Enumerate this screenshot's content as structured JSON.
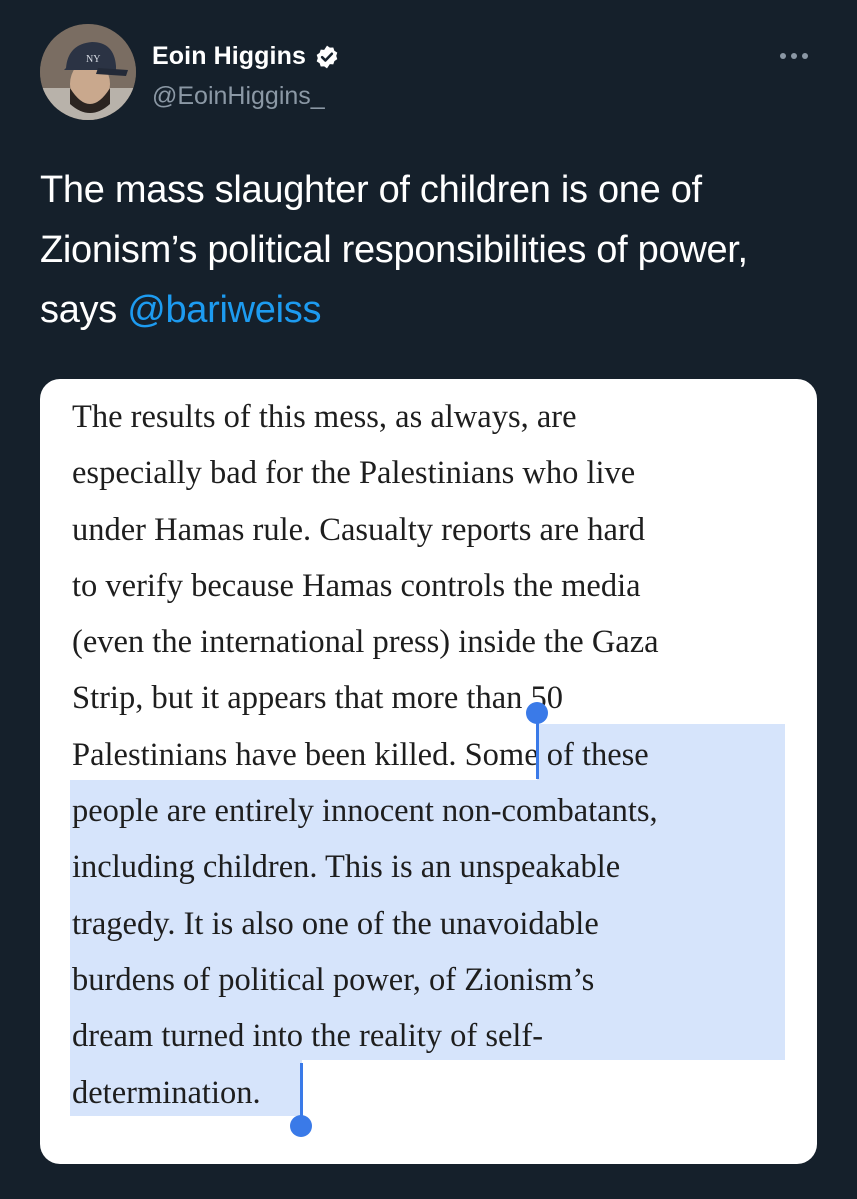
{
  "tweet": {
    "author_name": "Eoin Higgins",
    "author_handle": "@EoinHiggins_",
    "text_before_mention": "The mass slaughter of children is one of Zionism’s political responsibilities of power, says ",
    "mention": "@bariweiss"
  },
  "article": {
    "lines": [
      "The results of this mess, as always, are",
      "especially bad for the Palestinians who live",
      "under Hamas rule. Casualty reports are hard",
      "to verify because Hamas controls the media",
      "(even the international press) inside the Gaza",
      "Strip, but it appears that more than 50",
      "Palestinians have been killed. Some of these",
      "people are entirely innocent non-combatants,",
      "including children. This is an unspeakable",
      "tragedy. It is also one of the unavoidable",
      "burdens of political power, of Zionism’s",
      "dream turned into the reality of self-",
      "determination."
    ]
  },
  "icons": {
    "verified": "verified-badge-icon",
    "more": "more-options-icon"
  },
  "colors": {
    "background": "#15202b",
    "accent": "#1d9bf0",
    "selection_highlight": "#d6e4fb",
    "selection_handle": "#3a7ae8"
  }
}
